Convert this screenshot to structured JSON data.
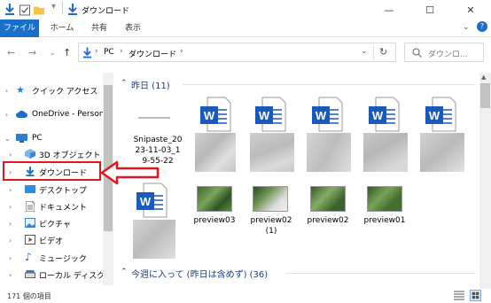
{
  "window": {
    "title": "ダウンロード"
  },
  "ribbon": {
    "tabs": [
      "ファイル",
      "ホーム",
      "共有",
      "表示"
    ]
  },
  "address": {
    "crumbs": [
      "PC",
      "ダウンロード"
    ],
    "search_placeholder": "ダウンロ..."
  },
  "sidebar": {
    "items": [
      {
        "label": "クイック アクセス"
      },
      {
        "label": "OneDrive - Person"
      },
      {
        "label": "PC"
      },
      {
        "label": "3D オブジェクト"
      },
      {
        "label": "ダウンロード"
      },
      {
        "label": "デスクトップ"
      },
      {
        "label": "ドキュメント"
      },
      {
        "label": "ピクチャ"
      },
      {
        "label": "ビデオ"
      },
      {
        "label": "ミュージック"
      },
      {
        "label": "ローカル ディスク (C"
      }
    ]
  },
  "groups": [
    {
      "header": "昨日 (11)"
    },
    {
      "header": "今週に入って (昨日は含めず) (36)"
    }
  ],
  "files": [
    {
      "name": "Snipaste_20\n23-11-03_1\n9-55-22"
    },
    {
      "name": "preview03"
    },
    {
      "name": "preview02\n(1)"
    },
    {
      "name": "preview02"
    },
    {
      "name": "preview01"
    }
  ],
  "status": {
    "item_count": "171 個の項目"
  },
  "colors": {
    "accent": "#1a6fc9",
    "highlight": "#e4161d",
    "word_blue": "#185abd"
  }
}
